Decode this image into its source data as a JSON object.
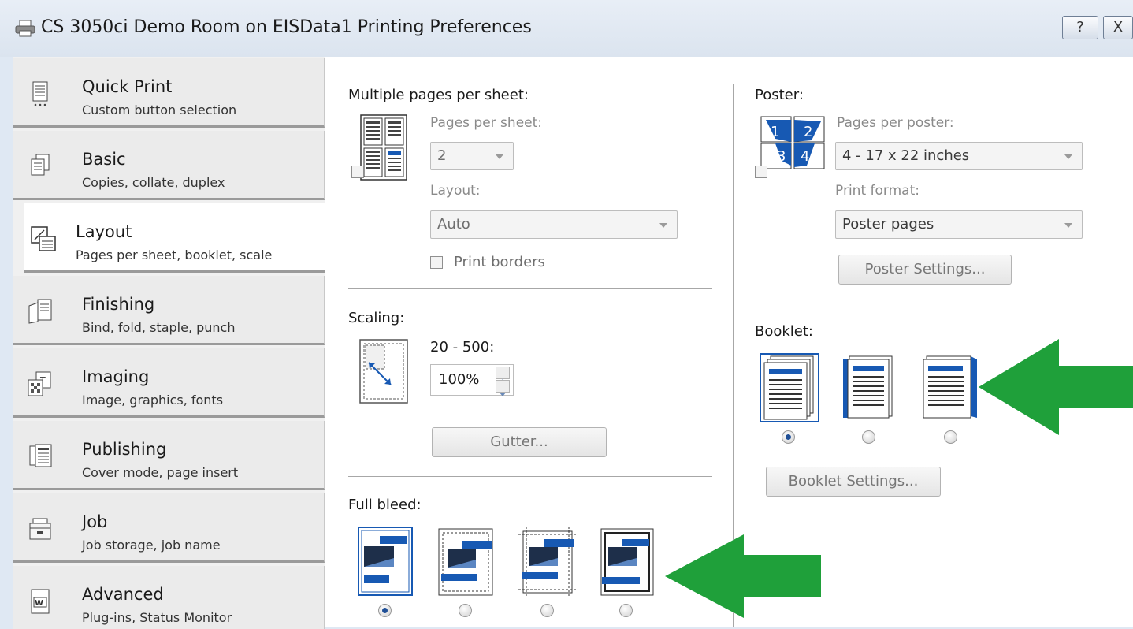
{
  "window": {
    "title": "CS 3050ci Demo Room on EISData1 Printing Preferences",
    "help_label": "?",
    "close_label": "X"
  },
  "sidebar": {
    "items": [
      {
        "title": "Quick Print",
        "subtitle": "Custom button selection",
        "icon": "quick-print-icon",
        "active": false
      },
      {
        "title": "Basic",
        "subtitle": "Copies, collate, duplex",
        "icon": "basic-icon",
        "active": false
      },
      {
        "title": "Layout",
        "subtitle": "Pages per sheet, booklet, scale",
        "icon": "layout-icon",
        "active": true
      },
      {
        "title": "Finishing",
        "subtitle": "Bind, fold, staple, punch",
        "icon": "finishing-icon",
        "active": false
      },
      {
        "title": "Imaging",
        "subtitle": "Image, graphics, fonts",
        "icon": "imaging-icon",
        "active": false
      },
      {
        "title": "Publishing",
        "subtitle": "Cover mode, page insert",
        "icon": "publishing-icon",
        "active": false
      },
      {
        "title": "Job",
        "subtitle": "Job storage, job name",
        "icon": "job-icon",
        "active": false
      },
      {
        "title": "Advanced",
        "subtitle": "Plug-ins, Status Monitor",
        "icon": "advanced-icon",
        "active": false
      }
    ]
  },
  "multiple_pages": {
    "heading": "Multiple pages per sheet:",
    "pages_label": "Pages per sheet:",
    "pages_value": "2",
    "layout_label": "Layout:",
    "layout_value": "Auto",
    "print_borders_label": "Print borders",
    "enabled": false,
    "print_borders": false
  },
  "scaling": {
    "heading": "Scaling:",
    "range_label": "20 - 500:",
    "value": "100%",
    "gutter_label": "Gutter..."
  },
  "full_bleed": {
    "heading": "Full bleed:",
    "selected_index": 0
  },
  "poster": {
    "heading": "Poster:",
    "pages_label": "Pages per poster:",
    "pages_value": "4 - 17 x 22 inches",
    "format_label": "Print format:",
    "format_value": "Poster pages",
    "settings_label": "Poster Settings...",
    "enabled": false,
    "tiles": [
      "1",
      "2",
      "3",
      "4"
    ]
  },
  "booklet": {
    "heading": "Booklet:",
    "selected_index": 0,
    "settings_label": "Booklet Settings..."
  },
  "colors": {
    "accent_blue": "#1759b3",
    "arrow_green": "#1fa03a"
  }
}
